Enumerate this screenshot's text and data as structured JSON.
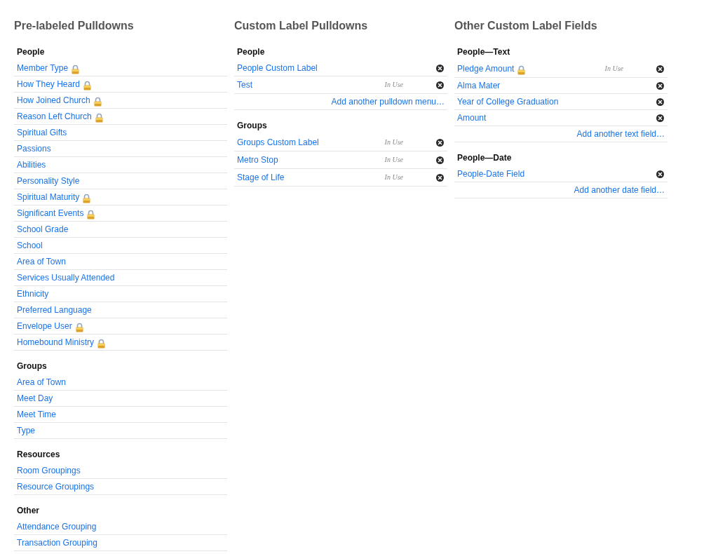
{
  "columns": [
    {
      "title": "Pre-labeled Pulldowns",
      "sections": [
        {
          "heading": "People",
          "rows": [
            {
              "label": "Member Type",
              "locked": true
            },
            {
              "label": "How They Heard",
              "locked": true
            },
            {
              "label": "How Joined Church",
              "locked": true
            },
            {
              "label": "Reason Left Church",
              "locked": true
            },
            {
              "label": "Spiritual Gifts",
              "locked": false
            },
            {
              "label": "Passions",
              "locked": false
            },
            {
              "label": "Abilities",
              "locked": false
            },
            {
              "label": "Personality Style",
              "locked": false
            },
            {
              "label": "Spiritual Maturity",
              "locked": true
            },
            {
              "label": "Significant Events",
              "locked": true
            },
            {
              "label": "School Grade",
              "locked": false
            },
            {
              "label": "School",
              "locked": false
            },
            {
              "label": "Area of Town",
              "locked": false
            },
            {
              "label": "Services Usually Attended",
              "locked": false
            },
            {
              "label": "Ethnicity",
              "locked": false
            },
            {
              "label": "Preferred Language",
              "locked": false
            },
            {
              "label": "Envelope User",
              "locked": true
            },
            {
              "label": "Homebound Ministry",
              "locked": true
            }
          ]
        },
        {
          "heading": "Groups",
          "rows": [
            {
              "label": "Area of Town",
              "locked": false
            },
            {
              "label": "Meet Day",
              "locked": false
            },
            {
              "label": "Meet Time",
              "locked": false
            },
            {
              "label": "Type",
              "locked": false
            }
          ]
        },
        {
          "heading": "Resources",
          "rows": [
            {
              "label": "Room Groupings",
              "locked": false
            },
            {
              "label": "Resource Groupings",
              "locked": false
            }
          ]
        },
        {
          "heading": "Other",
          "rows": [
            {
              "label": "Attendance Grouping",
              "locked": false
            },
            {
              "label": "Transaction Grouping",
              "locked": false
            }
          ]
        }
      ]
    },
    {
      "title": "Custom Label Pulldowns",
      "sections": [
        {
          "heading": "People",
          "rows": [
            {
              "label": "People Custom Label",
              "locked": false,
              "removable": true
            },
            {
              "label": "Test",
              "locked": false,
              "status": "In Use",
              "removable": true
            }
          ],
          "add_link": "Add another pulldown menu…"
        },
        {
          "heading": "Groups",
          "rows": [
            {
              "label": "Groups Custom Label",
              "locked": false,
              "status": "In Use",
              "removable": true
            },
            {
              "label": "Metro Stop",
              "locked": false,
              "status": "In Use",
              "removable": true
            },
            {
              "label": "Stage of Life",
              "locked": false,
              "status": "In Use",
              "removable": true
            }
          ]
        }
      ]
    },
    {
      "title": "Other Custom Label Fields",
      "sections": [
        {
          "heading": "People—Text",
          "rows": [
            {
              "label": "Pledge Amount",
              "locked": true,
              "status": "In Use",
              "removable": true
            },
            {
              "label": "Alma Mater",
              "locked": false,
              "removable": true
            },
            {
              "label": "Year of College Graduation",
              "locked": false,
              "removable": true
            },
            {
              "label": "Amount",
              "locked": false,
              "removable": true
            }
          ],
          "add_link": "Add another text field…"
        },
        {
          "heading": "People—Date",
          "rows": [
            {
              "label": "People-Date Field",
              "locked": false,
              "removable": true
            }
          ],
          "add_link": "Add another date field…"
        }
      ]
    }
  ]
}
